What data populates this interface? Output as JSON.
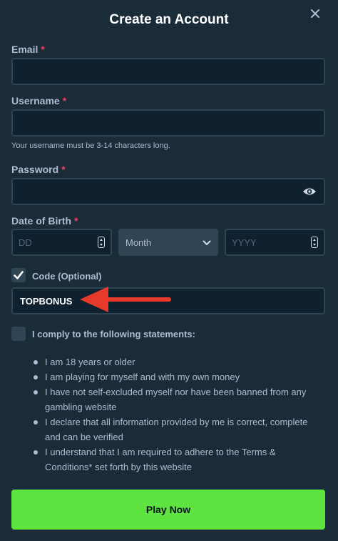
{
  "modal": {
    "title": "Create an Account",
    "close_icon": "close-icon"
  },
  "email": {
    "label": "Email",
    "required_mark": "*",
    "value": ""
  },
  "username": {
    "label": "Username",
    "required_mark": "*",
    "value": "",
    "hint": "Your username must be 3-14 characters long."
  },
  "password": {
    "label": "Password",
    "required_mark": "*",
    "value": "",
    "toggle_icon": "eye-icon"
  },
  "dob": {
    "label": "Date of Birth",
    "required_mark": "*",
    "day_placeholder": "DD",
    "month_selected": "Month",
    "year_placeholder": "YYYY"
  },
  "code": {
    "checked": true,
    "label": "Code (Optional)",
    "value": "TOPBONUS"
  },
  "comply": {
    "checked": false,
    "label": "I comply to the following statements:",
    "statements": [
      "I am 18 years or older",
      "I am playing for myself and with my own money",
      "I have not self-excluded myself nor have been banned from any gambling website",
      "I declare that all information provided by me is correct, complete and can be verified",
      "I understand that I am required to adhere to the Terms & Conditions* set forth by this website"
    ]
  },
  "submit": {
    "label": "Play Now"
  },
  "colors": {
    "background": "#1a2c38",
    "input": "#0f212e",
    "border": "#2f4553",
    "required": "#ed4163",
    "button": "#5fe341",
    "arrow": "#e83a2b"
  }
}
